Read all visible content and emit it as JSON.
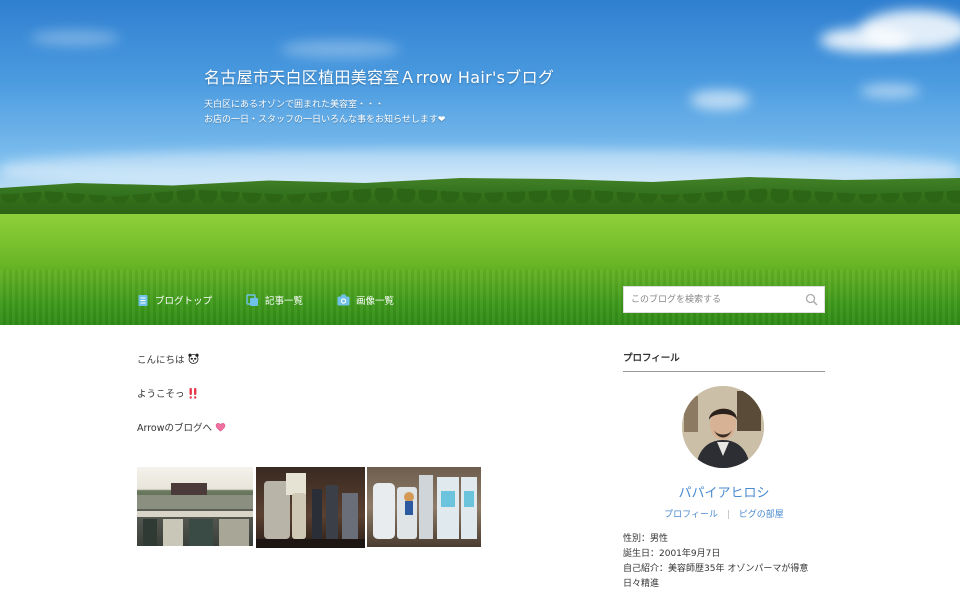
{
  "header": {
    "title": "名古屋市天白区植田美容室Ａrrow Hair'sブログ",
    "description_line1": "天白区にあるオゾンで囲まれた美容室・・・",
    "description_line2": "お店の一日・スタッフの一日いろんな事をお知らせします❤"
  },
  "nav": {
    "items": [
      {
        "label": "ブログトップ",
        "icon": "document-icon"
      },
      {
        "label": "記事一覧",
        "icon": "copy-icon"
      },
      {
        "label": "画像一覧",
        "icon": "camera-icon"
      }
    ]
  },
  "search": {
    "placeholder": "このブログを検索する",
    "icon": "search-icon"
  },
  "post": {
    "line1": "こんにちは",
    "line2": "ようこそっ",
    "line3": "Arrowのブログへ"
  },
  "sidebar": {
    "title": "プロフィール",
    "name": "パパイアヒロシ",
    "link_profile": "プロフィール",
    "link_room": "ピグの部屋",
    "separator": "|",
    "gender": "性別：男性",
    "birthday": "誕生日：2001年9月7日",
    "intro_line1": "自己紹介：美容師歴35年 オゾンパーマが得意",
    "intro_line2": "日々精進"
  },
  "colors": {
    "accent": "#4a8ad0",
    "nav_icon": "#6fc1e8"
  }
}
